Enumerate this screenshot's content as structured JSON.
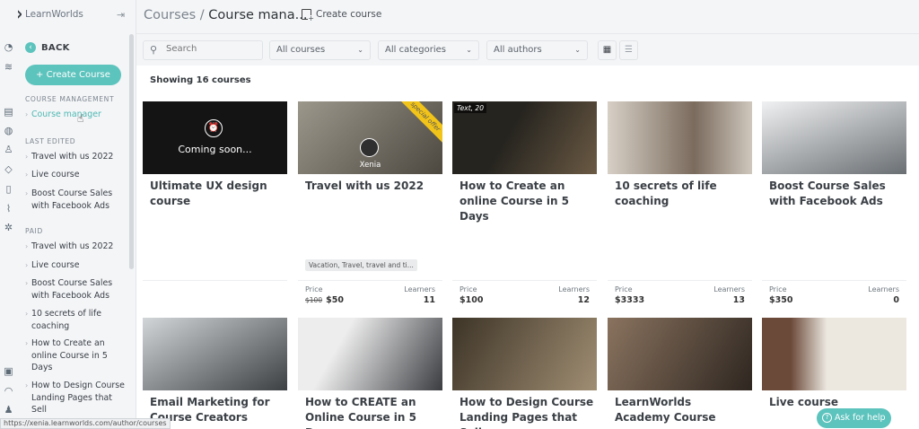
{
  "brand": {
    "name": "LearnWorlds"
  },
  "header": {
    "breadcrumb_root": "Courses",
    "breadcrumb_sep": " / ",
    "breadcrumb_current": "Course mana...",
    "create_label": "Create course"
  },
  "sidebar": {
    "back_label": "BACK",
    "create_button": "+ Create Course",
    "sections": [
      {
        "title": "COURSE MANAGEMENT",
        "items": [
          "Course manager"
        ]
      },
      {
        "title": "LAST EDITED",
        "items": [
          "Travel with us 2022",
          "Live course",
          "Boost Course Sales with Facebook Ads"
        ]
      },
      {
        "title": "PAID",
        "items": [
          "Travel with us 2022",
          "Live course",
          "Boost Course Sales with Facebook Ads",
          "10 secrets of life coaching",
          "How to Create an online Course in 5 Days",
          "How to Design Course Landing Pages that Sell"
        ]
      }
    ]
  },
  "filters": {
    "search_placeholder": "Search",
    "courses_select": "All courses",
    "categories_select": "All categories",
    "authors_select": "All authors"
  },
  "content": {
    "showing": "Showing 16 courses",
    "price_label": "Price",
    "learners_label": "Learners",
    "courses": [
      {
        "title": "Ultimate UX design course",
        "overlay": "Coming soon...",
        "tags": "",
        "price": "",
        "old_price": "",
        "learners": "",
        "thumb_colors": [
          "#151515",
          "#151515"
        ]
      },
      {
        "title": "Travel with us 2022",
        "ribbon": "special offer",
        "author": "Xenia",
        "tags": "Vacation, Travel, travel and ti...",
        "price": "$50",
        "old_price": "$100",
        "learners": "11",
        "thumb_colors": [
          "#8a8578",
          "#4a463f"
        ]
      },
      {
        "title": "How to Create an online Course in 5 Days",
        "badge": "Text, 20",
        "tags": "",
        "price": "$100",
        "old_price": "",
        "learners": "12",
        "thumb_colors": [
          "#2c2a26",
          "#6b5a44"
        ]
      },
      {
        "title": "10 secrets of life coaching",
        "tags": "",
        "price": "$3333",
        "old_price": "",
        "learners": "13",
        "thumb_colors": [
          "#cfc7bd",
          "#6a5d50"
        ]
      },
      {
        "title": "Boost Course Sales with Facebook Ads",
        "tags": "",
        "price": "$350",
        "old_price": "",
        "learners": "0",
        "thumb_colors": [
          "#e2e4e6",
          "#5d6266"
        ]
      },
      {
        "title": "Email Marketing for Course Creators",
        "thumb_colors": [
          "#cfd2d4",
          "#3c4043"
        ]
      },
      {
        "title": "How to CREATE an Online Course in 5 Days",
        "thumb_colors": [
          "#e8e8e8",
          "#3a3c40"
        ]
      },
      {
        "title": "How to Design Course Landing Pages that Sell",
        "thumb_colors": [
          "#3d3427",
          "#a08e73"
        ]
      },
      {
        "title": "LearnWorlds Academy Course",
        "thumb_colors": [
          "#7b6653",
          "#2e2620"
        ]
      },
      {
        "title": "Live course",
        "thumb_colors": [
          "#e9e5dd",
          "#6c4a3a"
        ]
      }
    ]
  },
  "help_button": "Ask for help",
  "status_url": "https://xenia.learnworlds.com/author/courses",
  "colors": {
    "accent": "#5cc3bd",
    "ribbon": "#f2c41a"
  }
}
